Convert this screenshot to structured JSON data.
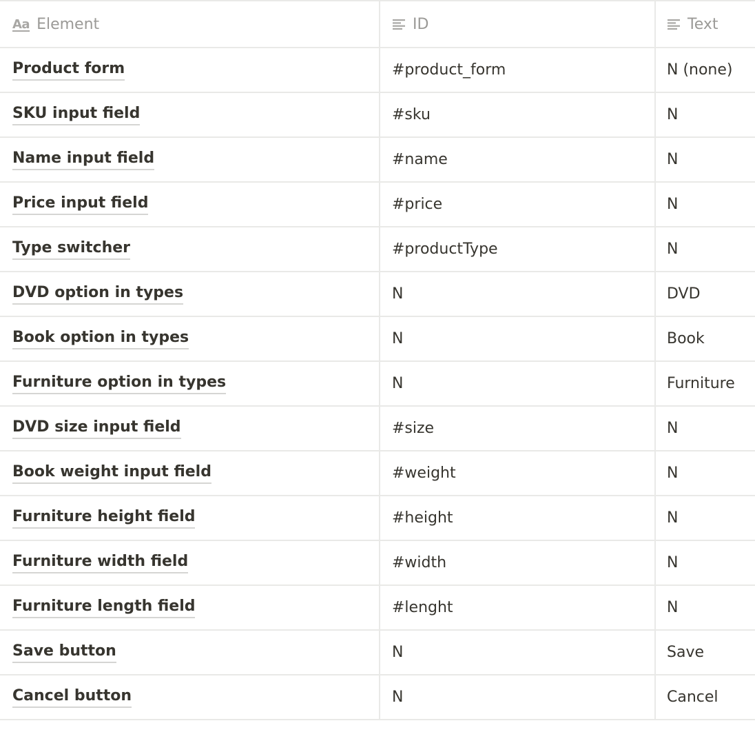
{
  "columns": [
    {
      "label": "Element",
      "icon": "title-property-icon"
    },
    {
      "label": "ID",
      "icon": "text-property-icon"
    },
    {
      "label": "Text",
      "icon": "text-property-icon"
    }
  ],
  "header_icon_text": "Aa",
  "rows": [
    {
      "element": "Product form",
      "id": "#product_form",
      "text": "N (none)"
    },
    {
      "element": "SKU input field",
      "id": "#sku",
      "text": "N"
    },
    {
      "element": "Name input field",
      "id": "#name",
      "text": "N"
    },
    {
      "element": "Price input field",
      "id": "#price",
      "text": "N"
    },
    {
      "element": "Type switcher",
      "id": "#productType",
      "text": "N"
    },
    {
      "element": "DVD option in types",
      "id": "N",
      "text": "DVD"
    },
    {
      "element": "Book option in types",
      "id": "N",
      "text": "Book"
    },
    {
      "element": "Furniture option in types",
      "id": "N",
      "text": "Furniture"
    },
    {
      "element": "DVD size input field",
      "id": "#size",
      "text": "N"
    },
    {
      "element": "Book weight input field",
      "id": "#weight",
      "text": "N"
    },
    {
      "element": "Furniture height field",
      "id": "#height",
      "text": "N"
    },
    {
      "element": "Furniture width field",
      "id": "#width",
      "text": "N"
    },
    {
      "element": "Furniture length field",
      "id": "#lenght",
      "text": "N"
    },
    {
      "element": "Save button",
      "id": "N",
      "text": "Save"
    },
    {
      "element": "Cancel button",
      "id": "N",
      "text": "Cancel"
    }
  ]
}
